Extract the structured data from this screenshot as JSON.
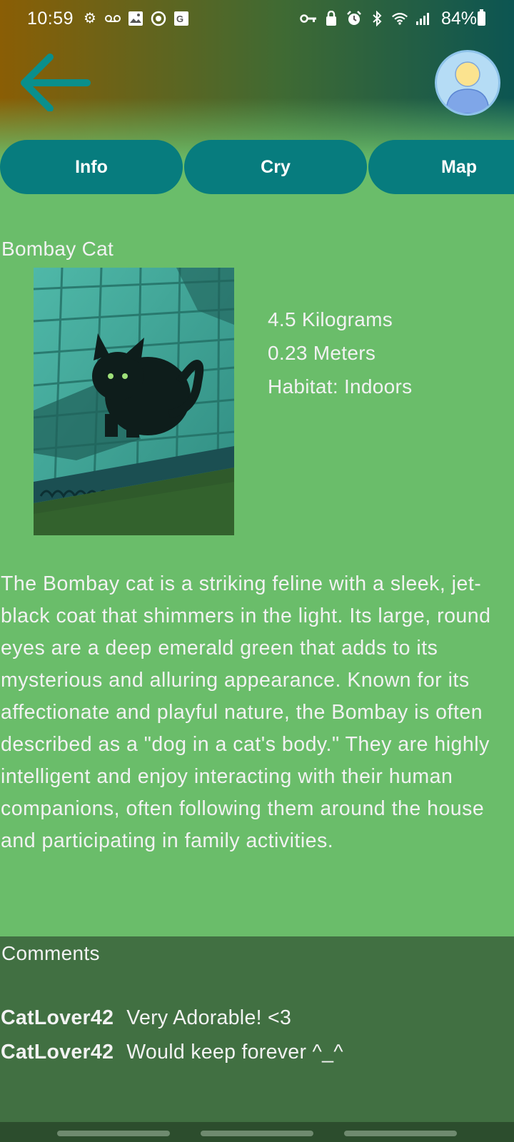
{
  "status_bar": {
    "time": "10:59",
    "battery": "84%",
    "left_icons": [
      "settings-icon",
      "voicemail-icon",
      "image-icon",
      "app-icon",
      "translate-icon"
    ],
    "right_icons": [
      "vpn-key-icon",
      "lock-icon",
      "alarm-icon",
      "bluetooth-icon",
      "wifi-icon",
      "signal-icon"
    ]
  },
  "header": {
    "back_icon": "arrow-left-icon",
    "avatar_icon": "user-avatar-icon",
    "gradient": [
      "#8a5e05",
      "#3f6a33",
      "#0c5552"
    ],
    "accent": "#0a8f8c"
  },
  "tabs": [
    {
      "label": "Info"
    },
    {
      "label": "Cry"
    },
    {
      "label": "Map"
    }
  ],
  "animal": {
    "name": "Bombay Cat",
    "weight": "4.5 Kilograms",
    "height": "0.23 Meters",
    "habitat": "Habitat: Indoors",
    "description": "The Bombay cat is a striking feline with a sleek, jet-black coat that shimmers in the light. Its large, round eyes are a deep emerald green that adds to its mysterious and alluring appearance. Known for its affectionate and playful nature, the Bombay is often described as a \"dog in a cat's body.\" They are highly intelligent and enjoy interacting with their human companions, often following them around the house and participating in family activities."
  },
  "comments": {
    "title": "Comments",
    "items": [
      {
        "user": "CatLover42",
        "text": "Very Adorable! <3"
      },
      {
        "user": "CatLover42",
        "text": "Would keep forever ^_^"
      }
    ]
  },
  "colors": {
    "background": "#6abd6a",
    "tab": "#077c7e",
    "comments_panel": "#417042",
    "nav_bar": "#2c4d2d"
  }
}
